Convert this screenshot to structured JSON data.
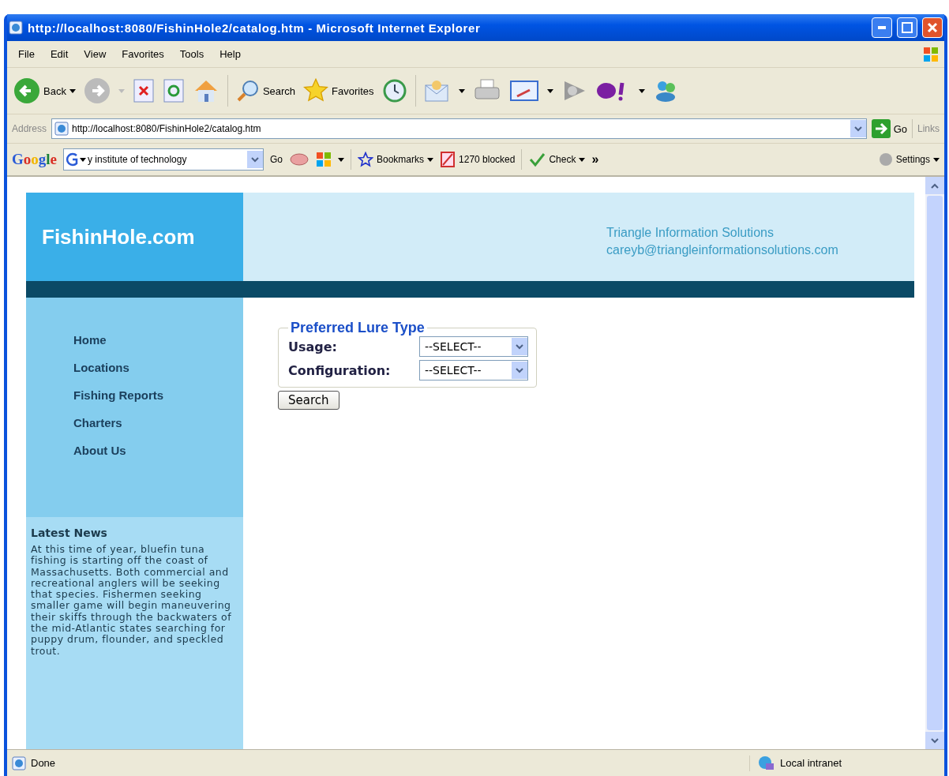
{
  "window": {
    "title": "http://localhost:8080/FishinHole2/catalog.htm - Microsoft Internet Explorer"
  },
  "menu": [
    "File",
    "Edit",
    "View",
    "Favorites",
    "Tools",
    "Help"
  ],
  "toolbar": {
    "back": "Back",
    "search": "Search",
    "favorites": "Favorites"
  },
  "address_bar": {
    "label": "Address",
    "url": "http://localhost:8080/FishinHole2/catalog.htm",
    "go": "Go",
    "links": "Links"
  },
  "google_bar": {
    "logo": "Google",
    "query": "y institute of technology",
    "go": "Go",
    "bookmarks": "Bookmarks",
    "blocked": "1270 blocked",
    "check": "Check",
    "more": "»",
    "settings": "Settings"
  },
  "page": {
    "site_name": "FishinHole.com",
    "company": "Triangle Information Solutions",
    "email": "careyb@triangleinformationsolutions.com",
    "nav": [
      "Home",
      "Locations",
      "Fishing Reports",
      "Charters",
      "About Us"
    ],
    "news": {
      "title": "Latest News",
      "body": "At this time of year, bluefin tuna fishing is starting off the coast of Massachusetts. Both commercial and recreational anglers will be seeking that species. Fishermen seeking smaller game will begin maneuvering their skiffs through the backwaters of the mid-Atlantic states searching for puppy drum, flounder, and speckled trout."
    },
    "form": {
      "legend": "Preferred Lure Type",
      "fields": [
        {
          "label": "Usage:",
          "value": "--SELECT--"
        },
        {
          "label": "Configuration:",
          "value": "--SELECT--"
        }
      ],
      "button": "Search"
    }
  },
  "status_bar": {
    "text": "Done",
    "zone": "Local intranet"
  }
}
